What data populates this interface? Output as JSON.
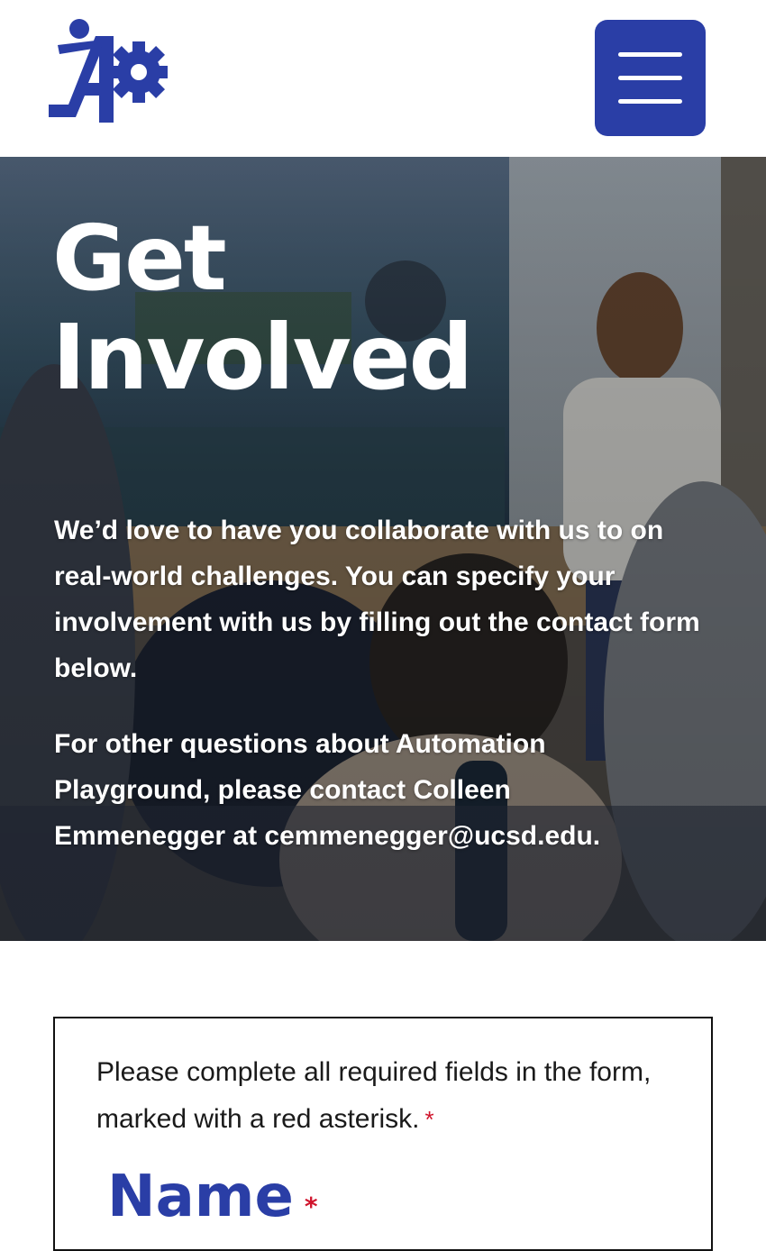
{
  "colors": {
    "brand": "#2a3ea6",
    "required": "#d0142c",
    "hero_text": "#ffffff",
    "body_text": "#1a1a1a"
  },
  "header": {
    "logo_icon": "automation-playground-gear-logo-icon",
    "menu_icon": "hamburger-menu-icon"
  },
  "hero": {
    "title": "Get Involved",
    "paragraph_1": "We’d love to have you collaborate with us to on real-world challenges. You can specify your involvement with us by filling out the contact form below.",
    "paragraph_2": "For other questions about Automation Playground, please contact Colleen Emmenegger at cemmenegger@ucsd.edu."
  },
  "form": {
    "instructions": "Please complete all required fields in the form, marked with a red asterisk.",
    "required_marker": "*",
    "name_label": "Name"
  }
}
